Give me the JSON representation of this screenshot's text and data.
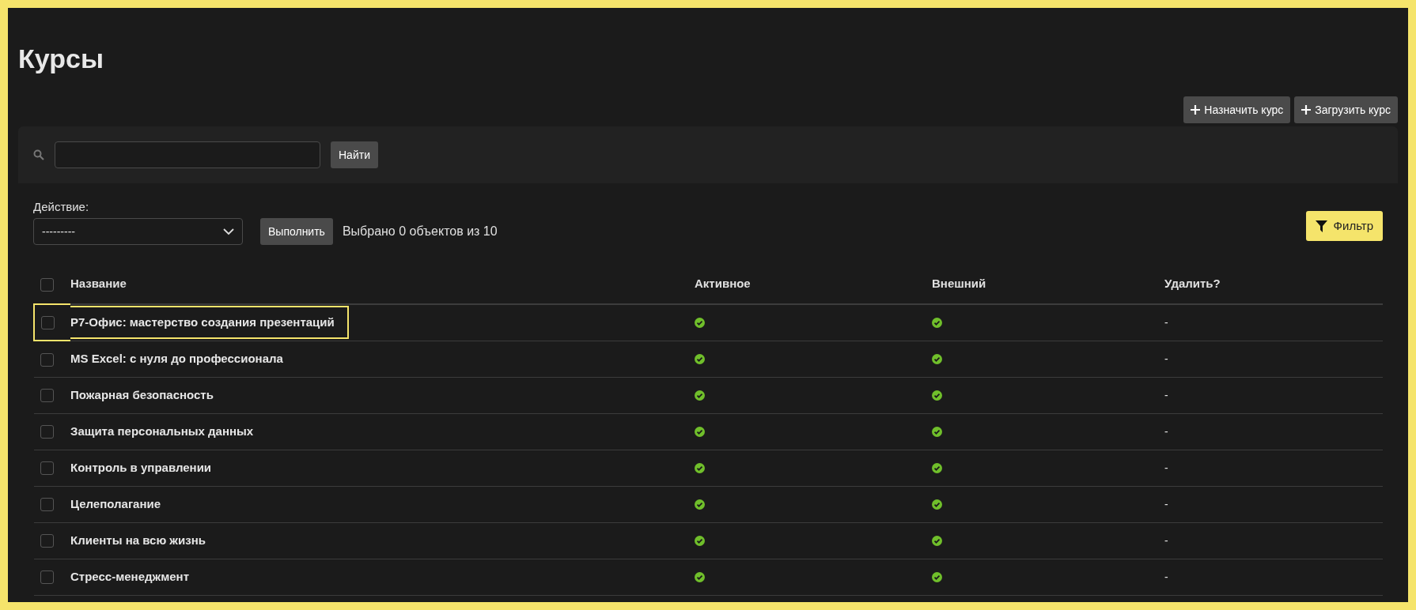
{
  "page_title": "Курсы",
  "header_buttons": [
    {
      "label": "Назначить курс"
    },
    {
      "label": "Загрузить курс"
    }
  ],
  "search": {
    "button": "Найти"
  },
  "actions": {
    "label": "Действие:",
    "select_value": "---------",
    "run_button": "Выполнить",
    "selection_counter": "Выбрано 0 объектов из 10",
    "filter_button": "Фильтр"
  },
  "table": {
    "select_all_checked": false,
    "columns": [
      "Название",
      "Активное",
      "Внешний",
      "Удалить?"
    ],
    "rows": [
      {
        "name": "Р7-Офис: мастерство создания презентаций",
        "active": true,
        "external": true,
        "delete": "-",
        "checked": false,
        "focused": true
      },
      {
        "name": "MS Excel: с нуля до профессионала",
        "active": true,
        "external": true,
        "delete": "-",
        "checked": false,
        "focused": false
      },
      {
        "name": "Пожарная безопасность",
        "active": true,
        "external": true,
        "delete": "-",
        "checked": false,
        "focused": false
      },
      {
        "name": "Защита персональных данных",
        "active": true,
        "external": true,
        "delete": "-",
        "checked": false,
        "focused": false
      },
      {
        "name": "Контроль в управлении",
        "active": true,
        "external": true,
        "delete": "-",
        "checked": false,
        "focused": false
      },
      {
        "name": "Целеполагание",
        "active": true,
        "external": true,
        "delete": "-",
        "checked": false,
        "focused": false
      },
      {
        "name": "Клиенты на всю жизнь",
        "active": true,
        "external": true,
        "delete": "-",
        "checked": false,
        "focused": false
      },
      {
        "name": "Стресс-менеджмент",
        "active": true,
        "external": true,
        "delete": "-",
        "checked": false,
        "focused": false
      }
    ]
  }
}
